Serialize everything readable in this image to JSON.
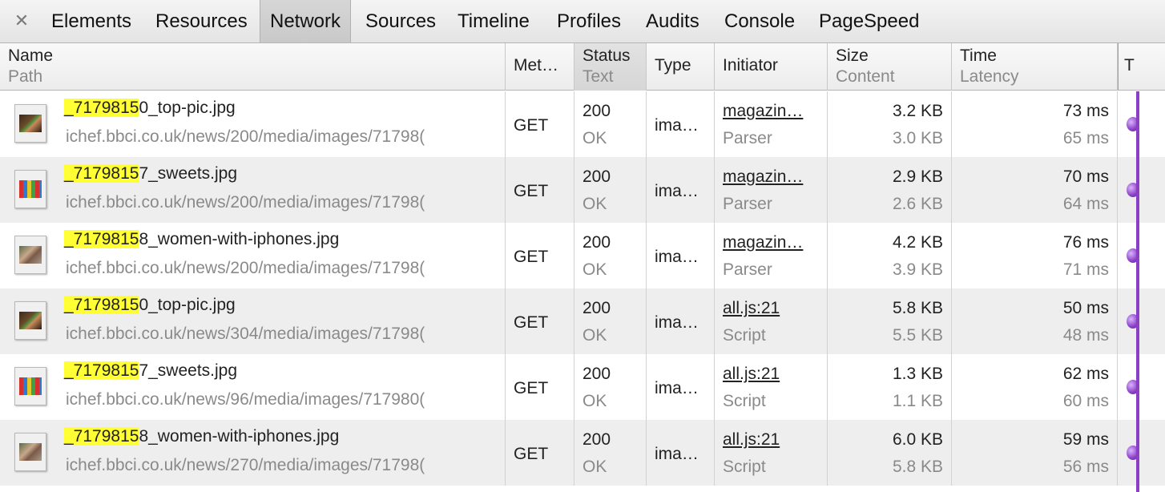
{
  "toolbar": {
    "close_glyph": "✕",
    "tabs": [
      {
        "label": "Elements"
      },
      {
        "label": "Resources"
      },
      {
        "label": "Network"
      },
      {
        "label": "Sources"
      },
      {
        "label": "Timeline"
      },
      {
        "label": "Profiles"
      },
      {
        "label": "Audits"
      },
      {
        "label": "Console"
      },
      {
        "label": "PageSpeed"
      }
    ],
    "active_tab": "Network"
  },
  "columns": {
    "name": {
      "title": "Name",
      "subtitle": "Path"
    },
    "method": {
      "title": "Met…"
    },
    "status": {
      "title": "Status",
      "subtitle": "Text"
    },
    "type": {
      "title": "Type"
    },
    "initiator": {
      "title": "Initiator"
    },
    "size": {
      "title": "Size",
      "subtitle": "Content"
    },
    "time": {
      "title": "Time",
      "subtitle": "Latency"
    },
    "timeline": {
      "title": "T"
    }
  },
  "rows": [
    {
      "name_hl": "_7179815",
      "name_rest": "0_top-pic.jpg",
      "path": "ichef.bbci.co.uk/news/200/media/images/71798(",
      "method": "GET",
      "status": "200",
      "status_text": "OK",
      "type": "ima…",
      "initiator": "magazin…",
      "initiator_type": "Parser",
      "size": "3.2 KB",
      "content": "3.0 KB",
      "time": "73 ms",
      "latency": "65 ms",
      "thumb": "top-pic"
    },
    {
      "name_hl": "_7179815",
      "name_rest": "7_sweets.jpg",
      "path": "ichef.bbci.co.uk/news/200/media/images/71798(",
      "method": "GET",
      "status": "200",
      "status_text": "OK",
      "type": "ima…",
      "initiator": "magazin…",
      "initiator_type": "Parser",
      "size": "2.9 KB",
      "content": "2.6 KB",
      "time": "70 ms",
      "latency": "64 ms",
      "thumb": "sweets"
    },
    {
      "name_hl": "_7179815",
      "name_rest": "8_women-with-iphones.jpg",
      "path": "ichef.bbci.co.uk/news/200/media/images/71798(",
      "method": "GET",
      "status": "200",
      "status_text": "OK",
      "type": "ima…",
      "initiator": "magazin…",
      "initiator_type": "Parser",
      "size": "4.2 KB",
      "content": "3.9 KB",
      "time": "76 ms",
      "latency": "71 ms",
      "thumb": "women"
    },
    {
      "name_hl": "_7179815",
      "name_rest": "0_top-pic.jpg",
      "path": "ichef.bbci.co.uk/news/304/media/images/71798(",
      "method": "GET",
      "status": "200",
      "status_text": "OK",
      "type": "ima…",
      "initiator": "all.js:21",
      "initiator_type": "Script",
      "size": "5.8 KB",
      "content": "5.5 KB",
      "time": "50 ms",
      "latency": "48 ms",
      "thumb": "top-pic"
    },
    {
      "name_hl": "_7179815",
      "name_rest": "7_sweets.jpg",
      "path": "ichef.bbci.co.uk/news/96/media/images/717980(",
      "method": "GET",
      "status": "200",
      "status_text": "OK",
      "type": "ima…",
      "initiator": "all.js:21",
      "initiator_type": "Script",
      "size": "1.3 KB",
      "content": "1.1 KB",
      "time": "62 ms",
      "latency": "60 ms",
      "thumb": "sweets"
    },
    {
      "name_hl": "_7179815",
      "name_rest": "8_women-with-iphones.jpg",
      "path": "ichef.bbci.co.uk/news/270/media/images/71798(",
      "method": "GET",
      "status": "200",
      "status_text": "OK",
      "type": "ima…",
      "initiator": "all.js:21",
      "initiator_type": "Script",
      "size": "6.0 KB",
      "content": "5.8 KB",
      "time": "59 ms",
      "latency": "56 ms",
      "thumb": "women"
    }
  ],
  "colors": {
    "highlight": "#ffff33",
    "timeline": "#8a3fc4",
    "row_alt": "#eeeeee"
  }
}
